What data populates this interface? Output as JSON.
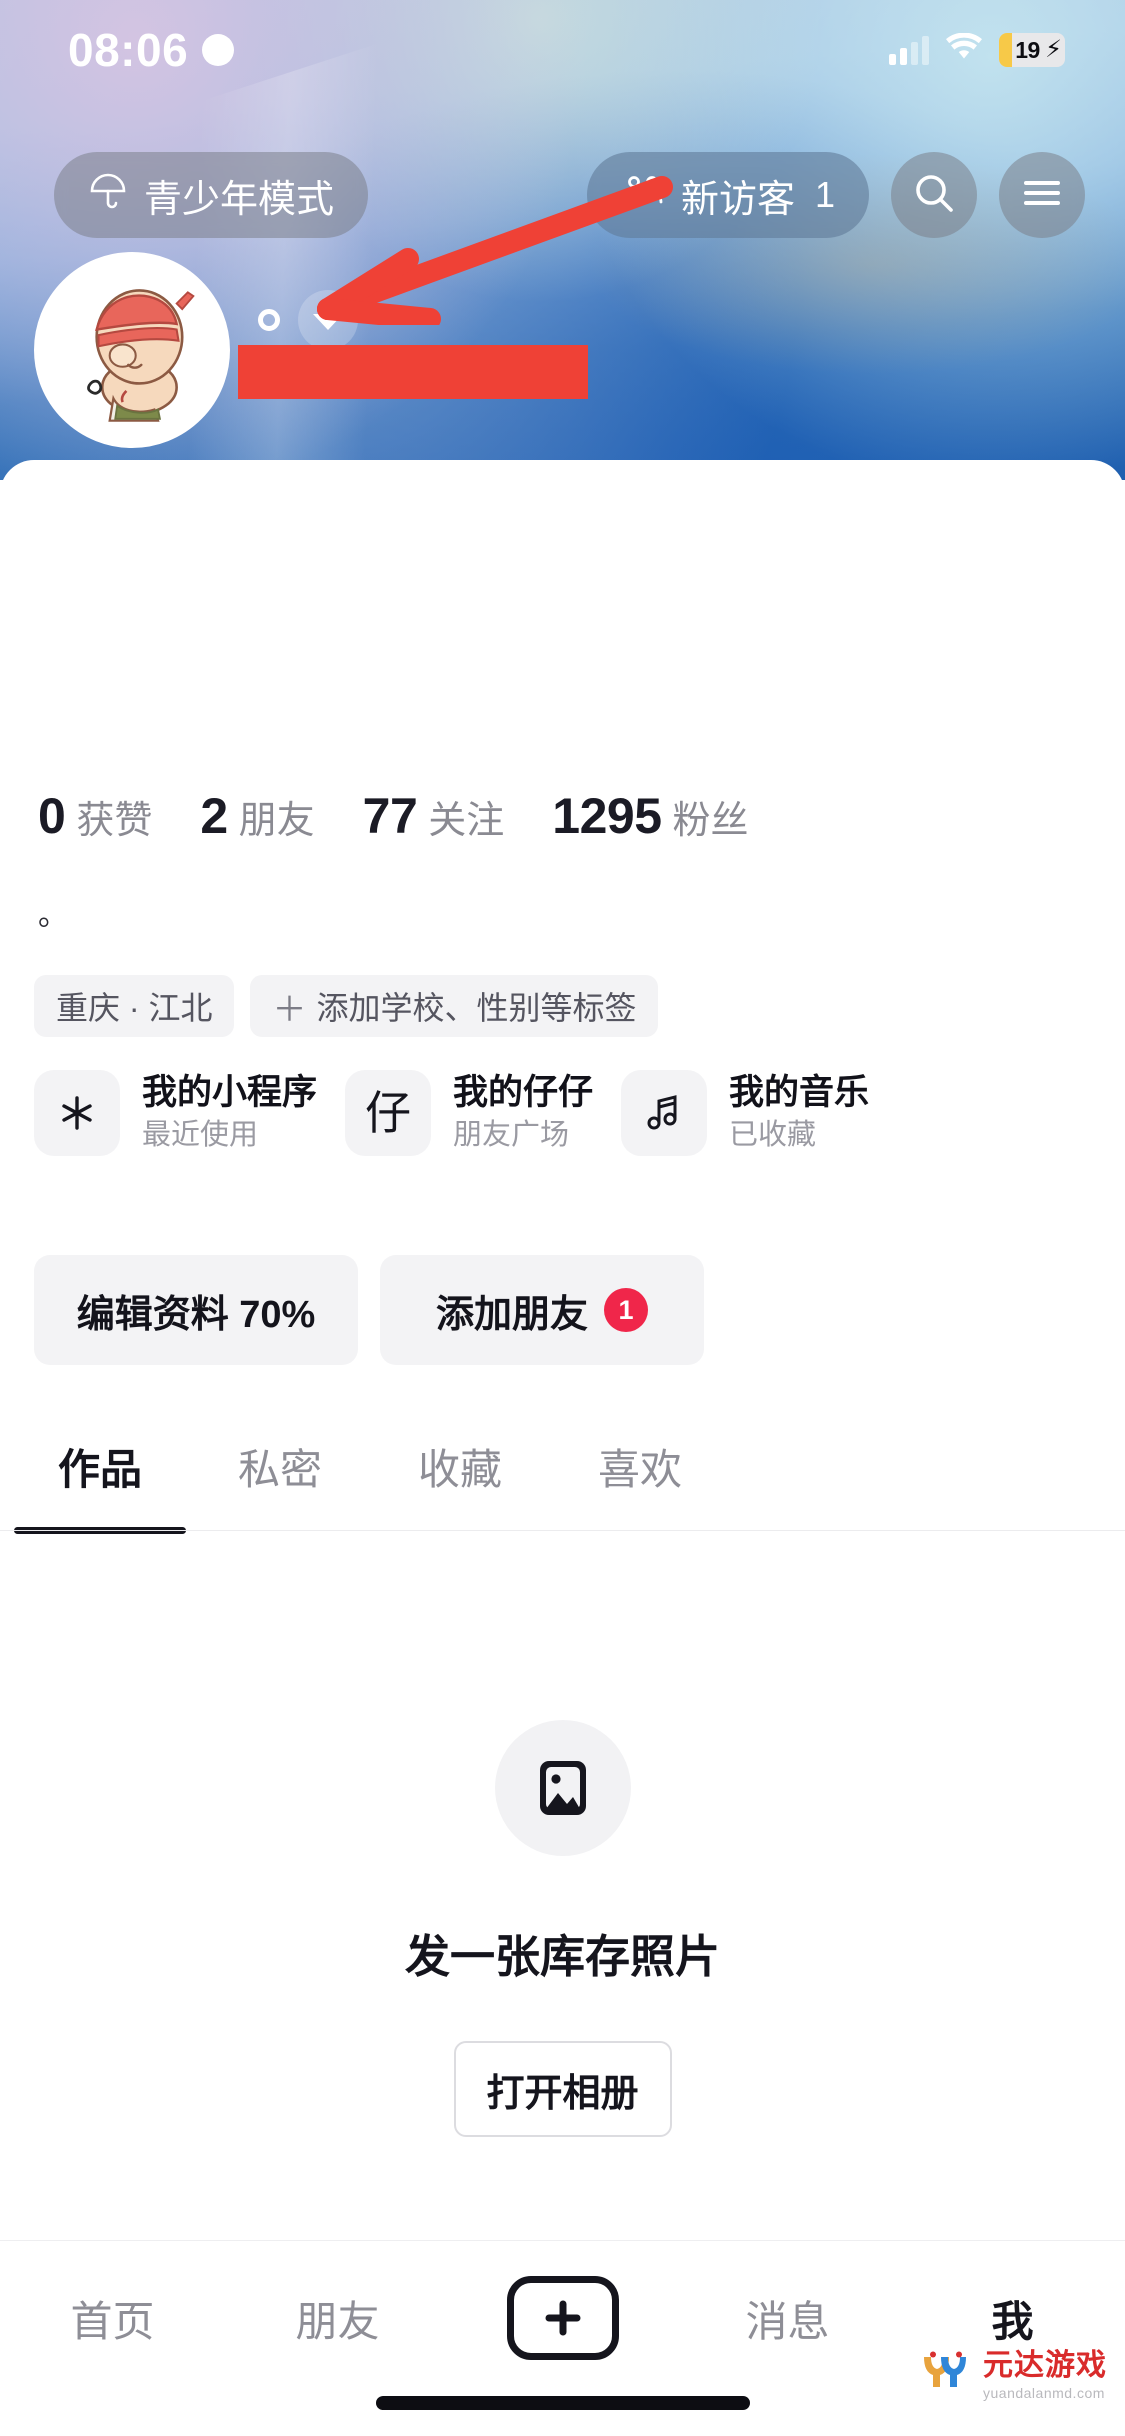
{
  "status_bar": {
    "time": "08:06",
    "dnd_icon": "moon-icon",
    "signal_icon": "signal-bars-icon",
    "wifi_icon": "wifi-icon",
    "battery_percent": "19",
    "battery_charging_icon": "lightning-bolt-icon"
  },
  "header": {
    "teen_mode": {
      "label": "青少年模式",
      "icon": "umbrella-icon"
    },
    "visitors": {
      "label": "新访客",
      "count": "1",
      "icon": "people-icon"
    },
    "search_icon": "search-icon",
    "menu_icon": "hamburger-menu-icon"
  },
  "profile": {
    "avatar_icon": "avatar-cartoon-character",
    "name_redacted": true,
    "name_dropdown_icon": "chevron-down-icon",
    "bio": "。",
    "stats": [
      {
        "value": "0",
        "label": "获赞"
      },
      {
        "value": "2",
        "label": "朋友"
      },
      {
        "value": "77",
        "label": "关注"
      },
      {
        "value": "1295",
        "label": "粉丝"
      }
    ],
    "tags": [
      {
        "text": "重庆 · 江北",
        "has_plus": false
      },
      {
        "text": "添加学校、性别等标签",
        "has_plus": true,
        "plus": "＋"
      }
    ]
  },
  "service_cards": [
    {
      "icon": "asterisk-icon",
      "icon_glyph": "",
      "title": "我的小程序",
      "subtitle": "最近使用"
    },
    {
      "icon": "zai-character-icon",
      "icon_glyph": "仔",
      "title": "我的仔仔",
      "subtitle": "朋友广场"
    },
    {
      "icon": "music-note-icon",
      "icon_glyph": "♬",
      "title": "我的音乐",
      "subtitle": "已收藏"
    }
  ],
  "actions": [
    {
      "label": "编辑资料 70%",
      "badge": null
    },
    {
      "label": "添加朋友",
      "badge": "1",
      "badge_color": "#f0264a"
    }
  ],
  "tabs": [
    {
      "label": "作品",
      "active": true
    },
    {
      "label": "私密",
      "active": false
    },
    {
      "label": "收藏",
      "active": false
    },
    {
      "label": "喜欢",
      "active": false
    }
  ],
  "empty_state": {
    "icon": "image-placeholder-icon",
    "title": "发一张库存照片",
    "button_label": "打开相册"
  },
  "bottom_nav": [
    {
      "label": "首页",
      "active": false
    },
    {
      "label": "朋友",
      "active": false
    },
    {
      "label": "",
      "icon": "plus-icon",
      "active": false
    },
    {
      "label": "消息",
      "active": false
    },
    {
      "label": "我",
      "active": true
    }
  ],
  "annotation": {
    "arrow_color": "#ef4136",
    "redaction_color": "#ef4136"
  },
  "watermark": {
    "logo": "YD-logo-icon",
    "title": "元达游戏",
    "url": "yuandalanmd.com"
  }
}
